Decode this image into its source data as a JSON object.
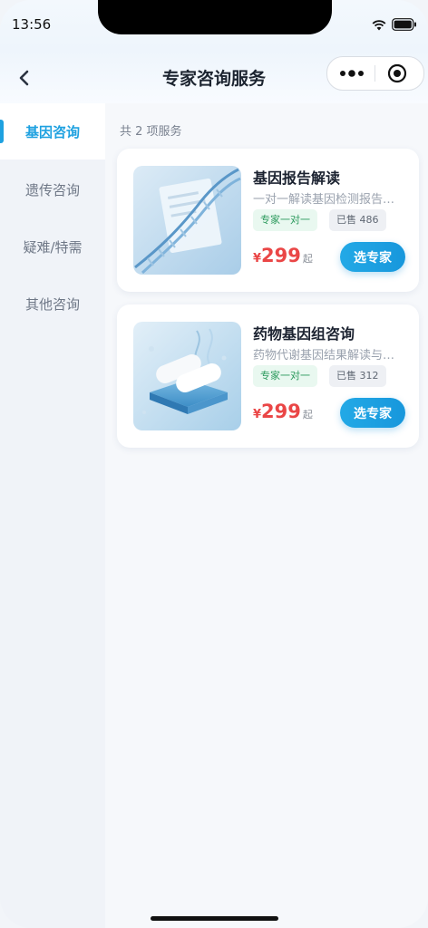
{
  "status": {
    "time": "13:56"
  },
  "nav": {
    "title": "专家咨询服务"
  },
  "sidebar": {
    "items": [
      {
        "label": "基因咨询",
        "active": true
      },
      {
        "label": "遗传咨询",
        "active": false
      },
      {
        "label": "疑难/特需",
        "active": false
      },
      {
        "label": "其他咨询",
        "active": false
      }
    ]
  },
  "main": {
    "count_text": "共 2 项服务",
    "cards": [
      {
        "title": "基因报告解读",
        "desc": "一对一解读基因检测报告…",
        "tag_primary": "专家一对一",
        "sold": "已售 486",
        "currency": "¥",
        "price": "299",
        "price_suffix": "起",
        "button": "选专家"
      },
      {
        "title": "药物基因组咨询",
        "desc": "药物代谢基因结果解读与…",
        "tag_primary": "专家一对一",
        "sold": "已售 312",
        "currency": "¥",
        "price": "299",
        "price_suffix": "起",
        "button": "选专家"
      }
    ]
  },
  "colors": {
    "accent": "#1ea1e0",
    "price": "#ea4646",
    "tag_green": "#2c9a5d"
  },
  "icons": {
    "back": "chevron-left-icon",
    "more": "more-dots-icon",
    "close": "target-close-icon"
  }
}
